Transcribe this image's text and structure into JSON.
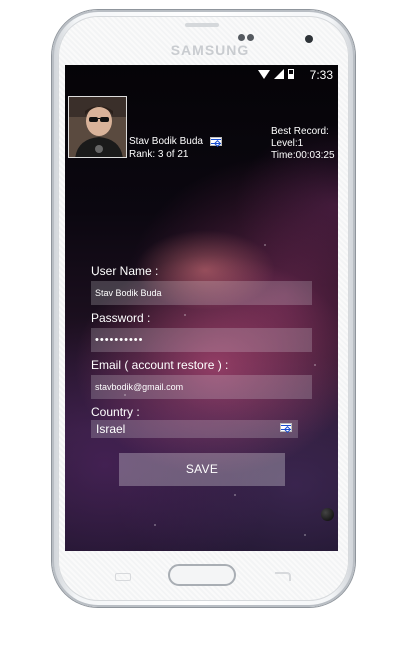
{
  "device": {
    "brand": "SAMSUNG"
  },
  "status_bar": {
    "time": "7:33",
    "icons": [
      "wifi-icon",
      "signal-icon",
      "battery-icon"
    ]
  },
  "profile": {
    "name": "Stav Bodik Buda",
    "rank": "Rank: 3 of 21",
    "country_flag": "israel-flag-icon"
  },
  "record": {
    "title": "Best Record:",
    "level": "Level:1",
    "time": "Time:00:03:25"
  },
  "form": {
    "username_label": "User Name :",
    "username_value": "Stav Bodik Buda",
    "password_label": "Password :",
    "password_value": "••••••••••",
    "email_label": "Email ( account restore ) :",
    "email_value": "stavbodik@gmail.com",
    "country_label": "Country :",
    "country_value": "Israel",
    "save_label": "SAVE"
  }
}
